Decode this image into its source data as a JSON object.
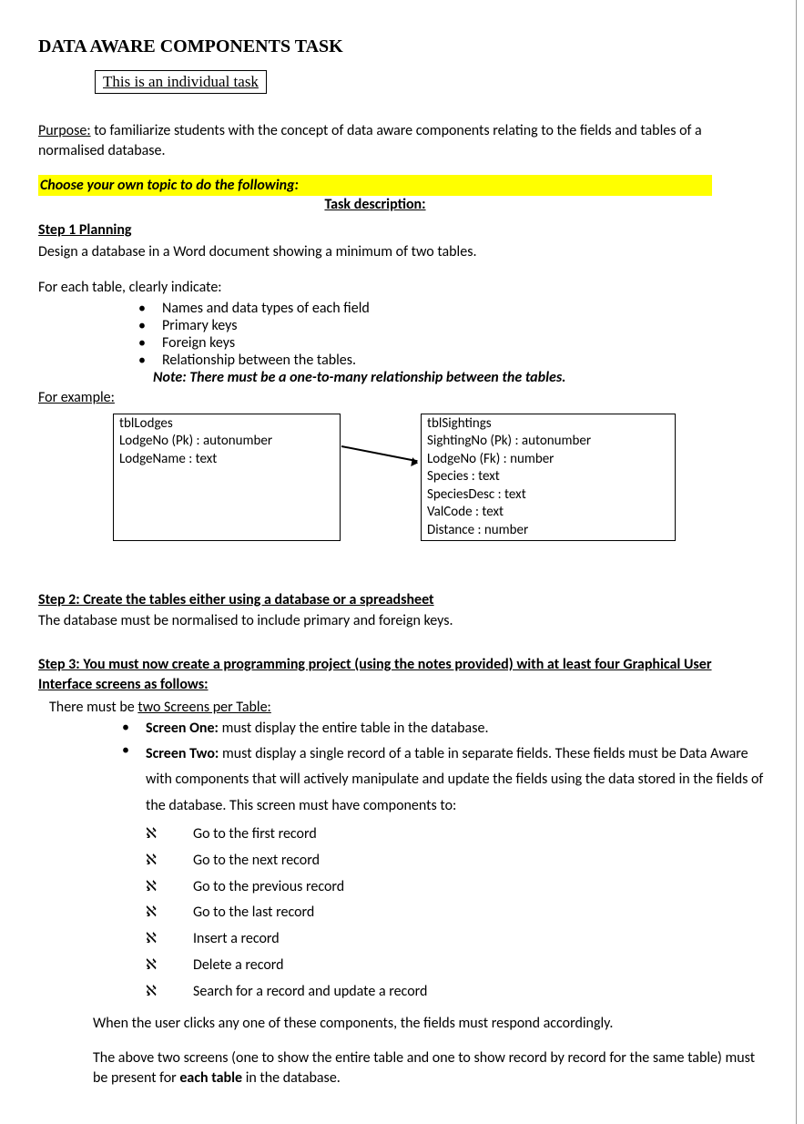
{
  "title": "DATA AWARE COMPONENTS TASK",
  "task_box": "This is an individual task",
  "purpose_label": "Purpose:",
  "purpose_text": " to familiarize students with the concept of data aware components relating to the fields and tables of a normalised database.",
  "choose_topic": "Choose your own topic to do the following:",
  "task_description": "Task description:",
  "step1_head": "Step 1 Planning",
  "step1_text": "Design a database in a Word document showing a minimum of two tables.",
  "for_each_table": "For each table, clearly indicate:",
  "table_bullets": [
    "Names and data types of each field",
    "Primary keys",
    "Foreign keys",
    "Relationship between the tables."
  ],
  "note_text": "Note: There must be a one-to-many relationship between the tables.",
  "for_example": "For example:",
  "db_left": {
    "name": "tblLodges",
    "rows": [
      "LodgeNo (Pk) : autonumber",
      "LodgeName : text"
    ]
  },
  "db_right": {
    "name": "tblSightings",
    "rows": [
      "SightingNo (Pk) : autonumber",
      "LodgeNo (Fk) : number",
      "Species : text",
      "SpeciesDesc : text",
      "ValCode : text",
      "Distance : number"
    ]
  },
  "step2_head": "Step 2: Create the tables either using a database or a spreadsheet",
  "step2_text": "The database must be normalised to include primary and foreign keys.",
  "step3_head": "Step 3: You must now create a programming project (using the notes provided) with at least four Graphical User Interface screens as follows:",
  "step3_intro_pre": "There must be ",
  "step3_intro_underline": "two Screens per Table:",
  "screen_one_label": "Screen One:",
  "screen_one_text": " must display the entire table in the database.",
  "screen_two_label": "Screen Two:",
  "screen_two_text": "  must display a single record of a table in separate fields.  These fields must be Data Aware with components that will actively manipulate and update the fields using the data stored in the fields of the database.  This screen must have components to:",
  "record_ops": [
    "Go to the first record",
    "Go to the next record",
    "Go to the previous record",
    "Go to the last record",
    "Insert a record",
    "Delete a record",
    "Search for a record and update a record"
  ],
  "closing1": "When the user clicks any one of these components, the fields must respond accordingly.",
  "closing2_pre": "The above two screens (one to show the entire table and one to show record by record for the same table) must be present for ",
  "closing2_bold": "each table",
  "closing2_post": " in the database."
}
